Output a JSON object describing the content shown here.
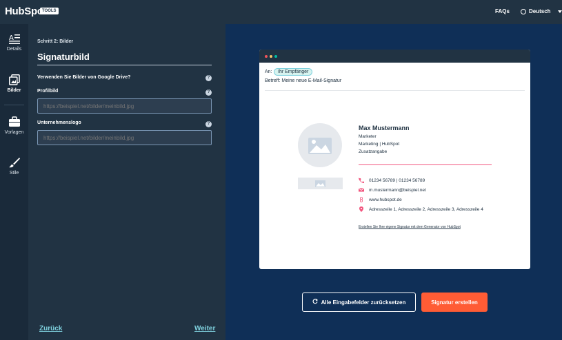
{
  "header": {
    "logo": "HubSpot",
    "logo_tag": "TOOLS",
    "faq": "FAQs",
    "language": "Deutsch"
  },
  "sidebar": {
    "items": [
      {
        "label": "Details",
        "icon": "details-icon"
      },
      {
        "label": "Bilder",
        "icon": "images-icon",
        "active": true
      },
      {
        "label": "Vorlagen",
        "icon": "briefcase-icon"
      },
      {
        "label": "Stile",
        "icon": "brush-icon"
      }
    ]
  },
  "form": {
    "step": "Schritt 2: Bilder",
    "title": "Signaturbild",
    "google_drive_question": "Verwenden Sie Bilder von Google Drive?",
    "profile_label": "Profilbild",
    "profile_placeholder": "https://beispiel.net/bilder/meinbild.jpg",
    "logo_label": "Unternehmenslogo",
    "logo_placeholder": "https://beispiel.net/bilder/meinbild.jpg",
    "back": "Zurück",
    "next": "Weiter"
  },
  "preview": {
    "to_label": "An:",
    "recipient": "Ihr Empfänger",
    "subject": "Betreff: Meine neue E-Mail-Signatur",
    "signature": {
      "name": "Max Mustermann",
      "role": "Marketer",
      "dept": "Marketing | HubSpot",
      "extra": "Zusatzangabe",
      "phone": "01234 56789 | 01234 56789",
      "email": "m.mustermann@beispiel.net",
      "website": "www.hubspot.de",
      "address": "Adresszeile 1, Adresszeile 2, Adresszeile 3, Adresszeile 4",
      "credit": "Erstellen Sie Ihre eigene Signatur mit dem Generator von HubSpot"
    },
    "accent_color": "#f2547d"
  },
  "actions": {
    "reset": "Alle Eingabefelder zurücksetzen",
    "create": "Signatur erstellen"
  }
}
